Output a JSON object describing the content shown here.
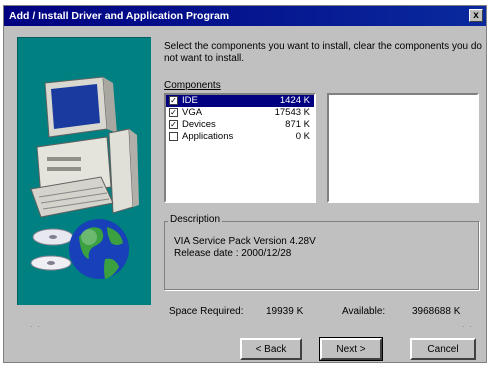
{
  "window": {
    "title": "Add / Install Driver and Application Program",
    "close_label": "x"
  },
  "instructions": "Select the components you want to install, clear the components you do not want to install.",
  "components": {
    "label": "Components",
    "items": [
      {
        "name": "IDE",
        "size": "1424 K",
        "checked": true,
        "selected": true
      },
      {
        "name": "VGA",
        "size": "17543 K",
        "checked": true,
        "selected": false
      },
      {
        "name": "Devices",
        "size": "871 K",
        "checked": true,
        "selected": false
      },
      {
        "name": "Applications",
        "size": "0 K",
        "checked": false,
        "selected": false
      }
    ]
  },
  "description": {
    "label": "Description",
    "line1": "VIA Service Pack Version 4.28V",
    "line2": "Release date : 2000/12/28"
  },
  "space": {
    "required_label": "Space Required:",
    "required_value": "19939 K",
    "available_label": "Available:",
    "available_value": "3968688 K"
  },
  "buttons": {
    "back": "< Back",
    "next": "Next >",
    "cancel": "Cancel"
  },
  "colors": {
    "title_bar": "#000080",
    "banner": "#008080",
    "dialog": "#c0c0c0"
  }
}
